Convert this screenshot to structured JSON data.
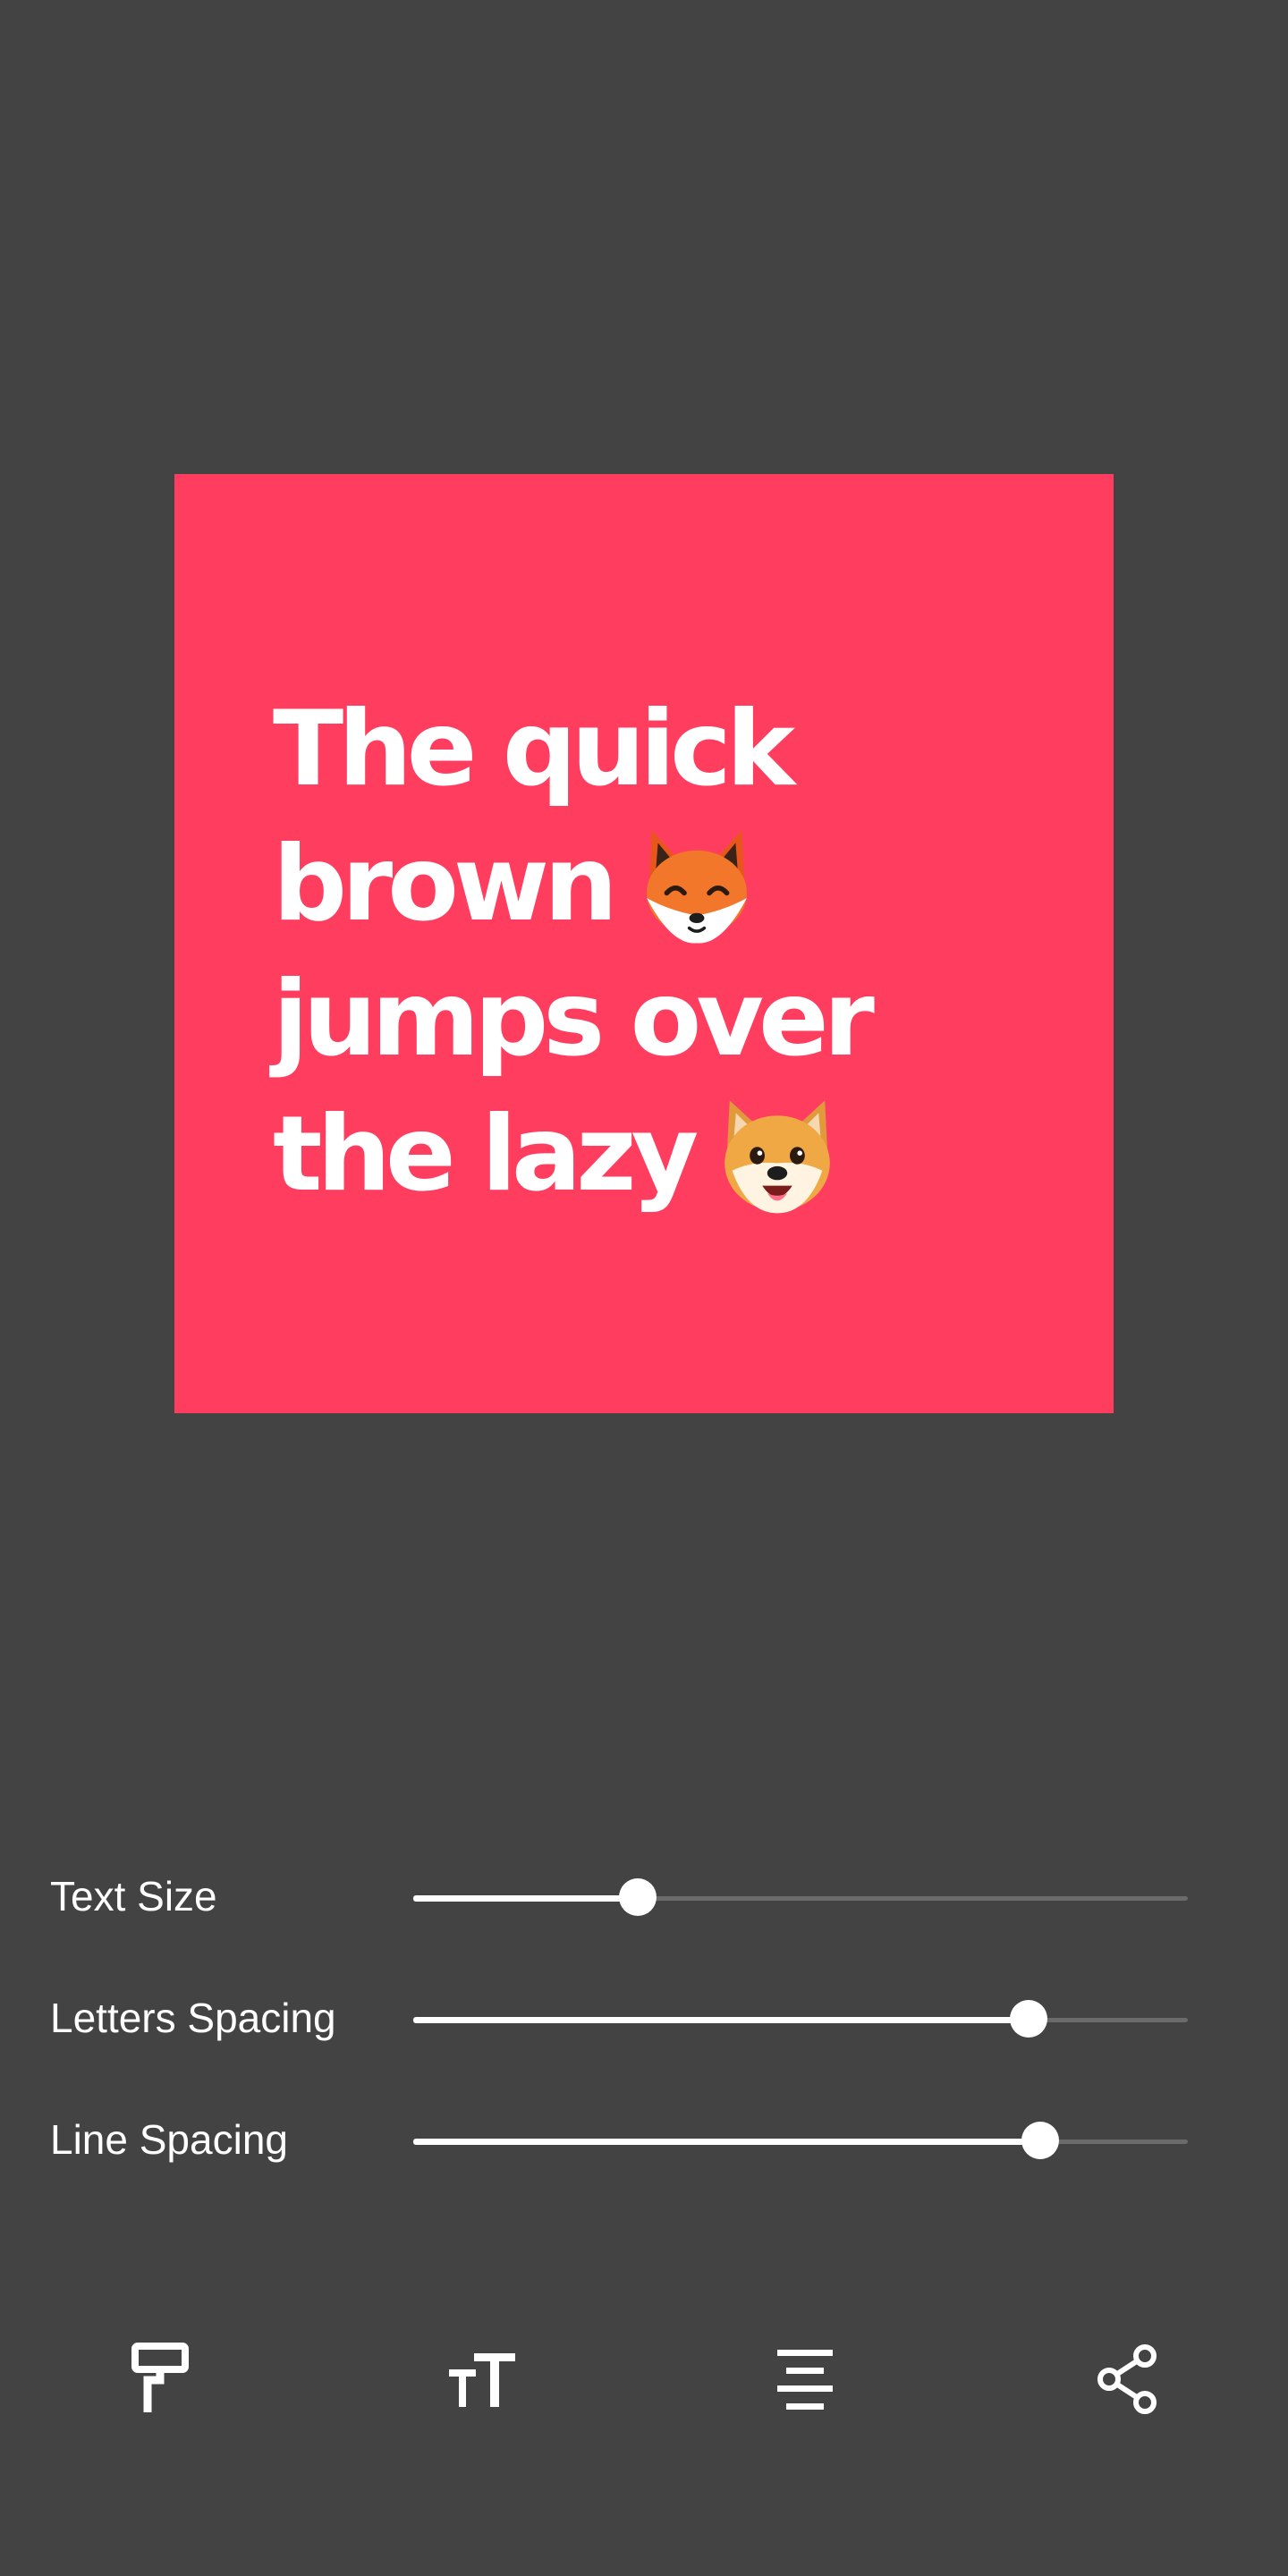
{
  "canvas": {
    "background_color": "#ff3e5f",
    "text_color": "#ffffff",
    "lines": [
      {
        "text": "The quick",
        "emoji": ""
      },
      {
        "text": "brown",
        "emoji": "fox-face-emoji"
      },
      {
        "text": "jumps over",
        "emoji": ""
      },
      {
        "text": "the lazy",
        "emoji": "dog-face-emoji"
      }
    ]
  },
  "controls": {
    "text_size": {
      "label": "Text Size",
      "value_fraction": 0.29
    },
    "letters_spacing": {
      "label": "Letters Spacing",
      "value_fraction": 0.795
    },
    "line_spacing": {
      "label": "Line Spacing",
      "value_fraction": 0.81
    }
  },
  "toolbar": {
    "items": [
      {
        "icon": "paint-roller-icon"
      },
      {
        "icon": "text-size-icon"
      },
      {
        "icon": "align-center-icon"
      },
      {
        "icon": "share-icon"
      }
    ]
  },
  "colors": {
    "background": "#434343",
    "accent": "#ff3e5f",
    "slider_active": "#ffffff",
    "slider_inactive": "#6b6b6b"
  }
}
